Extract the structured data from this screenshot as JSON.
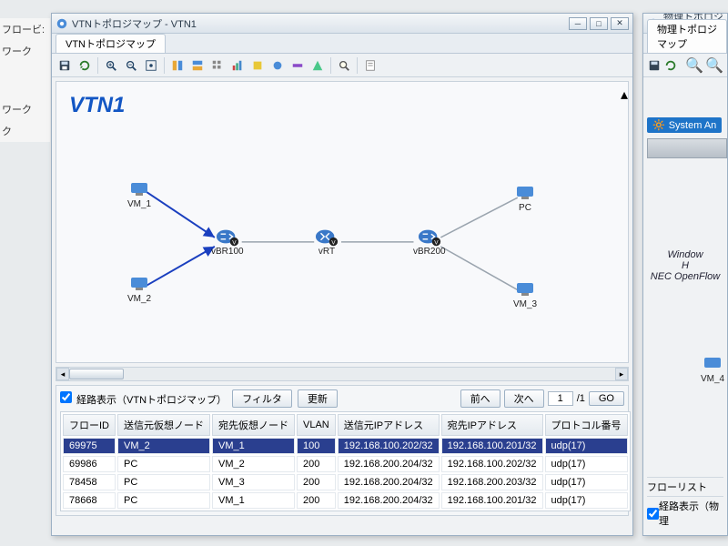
{
  "left_sidebar": {
    "items": [
      "",
      "フロービ:",
      "ワーク",
      "",
      "ワーク",
      "ク"
    ]
  },
  "main": {
    "title": "VTNトポロジマップ - VTN1",
    "tab": "VTNトポロジマップ",
    "canvas_title": "VTN1",
    "nodes": {
      "vm1": "VM_1",
      "vm2": "VM_2",
      "vm3": "VM_3",
      "pc": "PC",
      "vbr100": "vBR100",
      "vrt": "vRT",
      "vbr200": "vBR200"
    },
    "filter": {
      "checkbox_label": "経路表示（VTNトポロジマップ）",
      "filter_btn": "フィルタ",
      "refresh_btn": "更新",
      "prev_btn": "前へ",
      "next_btn": "次へ",
      "page_value": "1",
      "page_total": "/1",
      "go_btn": "GO"
    },
    "table": {
      "headers": [
        "フローID",
        "送信元仮想ノード",
        "宛先仮想ノード",
        "VLAN",
        "送信元IPアドレス",
        "宛先IPアドレス",
        "プロトコル番号"
      ],
      "rows": [
        {
          "sel": true,
          "cells": [
            "69975",
            "VM_2",
            "VM_1",
            "100",
            "192.168.100.202/32",
            "192.168.100.201/32",
            "udp(17)"
          ]
        },
        {
          "sel": false,
          "cells": [
            "69986",
            "PC",
            "VM_2",
            "200",
            "192.168.200.204/32",
            "192.168.100.202/32",
            "udp(17)"
          ]
        },
        {
          "sel": false,
          "cells": [
            "78458",
            "PC",
            "VM_3",
            "200",
            "192.168.200.204/32",
            "192.168.200.203/32",
            "udp(17)"
          ]
        },
        {
          "sel": false,
          "cells": [
            "78668",
            "PC",
            "VM_1",
            "200",
            "192.168.200.204/32",
            "192.168.100.201/32",
            "udp(17)"
          ]
        }
      ]
    }
  },
  "right": {
    "title": "物理トポロジマッ",
    "tab": "物理トポロジマップ",
    "badge": "System An",
    "text1": "Window",
    "text2": "H",
    "text3": "NEC OpenFlow",
    "node_label": "VM_4",
    "flowlist": "フローリスト",
    "route_label": "経路表示（物理"
  }
}
